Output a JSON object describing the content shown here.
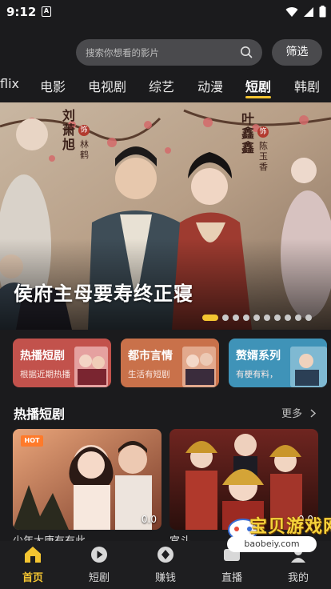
{
  "status_bar": {
    "time": "9:12",
    "notification_badge": "A"
  },
  "header": {
    "search_placeholder": "搜索你想看的影片",
    "filter_label": "筛选"
  },
  "tabs": [
    {
      "label": "flix"
    },
    {
      "label": "电影"
    },
    {
      "label": "电视剧"
    },
    {
      "label": "综艺"
    },
    {
      "label": "动漫"
    },
    {
      "label": "短剧",
      "active": true
    },
    {
      "label": "韩剧"
    }
  ],
  "hero": {
    "title": "侯府主母要寿终正寝",
    "cast_left": [
      "刘萧旭",
      "饰",
      "林鹤"
    ],
    "cast_right": [
      "叶鑫鑫",
      "饰",
      "陈玉香"
    ],
    "slide_index": 1,
    "slide_count": 10
  },
  "genres": [
    {
      "title": "热播短剧",
      "subtitle": "根据近期热播",
      "color": "#c2524c"
    },
    {
      "title": "都市言情",
      "subtitle": "生活有短剧",
      "color": "#c9714a"
    },
    {
      "title": "赘婿系列",
      "subtitle": "有梗有料，",
      "color": "#3f93b8"
    }
  ],
  "section": {
    "title": "热播短剧",
    "more_label": "更多"
  },
  "posters": [
    {
      "badge": "HOT",
      "score": "0.0",
      "title_fragment": "少年大唐有有此"
    },
    {
      "score": "0.0",
      "title_fragment": "宫斗"
    }
  ],
  "bottom_nav": [
    {
      "label": "首页",
      "icon": "home-icon",
      "active": true
    },
    {
      "label": "短剧",
      "icon": "play-circle-icon"
    },
    {
      "label": "赚钱",
      "icon": "coin-icon"
    },
    {
      "label": "直播",
      "icon": "live-icon"
    },
    {
      "label": "我的",
      "icon": "user-icon"
    }
  ],
  "watermark": {
    "text": "宝贝游戏网",
    "url": "baobeiy.com"
  },
  "colors": {
    "accent": "#f4c531",
    "background": "#1b1b1d",
    "search_bg": "#4a4a4d"
  }
}
